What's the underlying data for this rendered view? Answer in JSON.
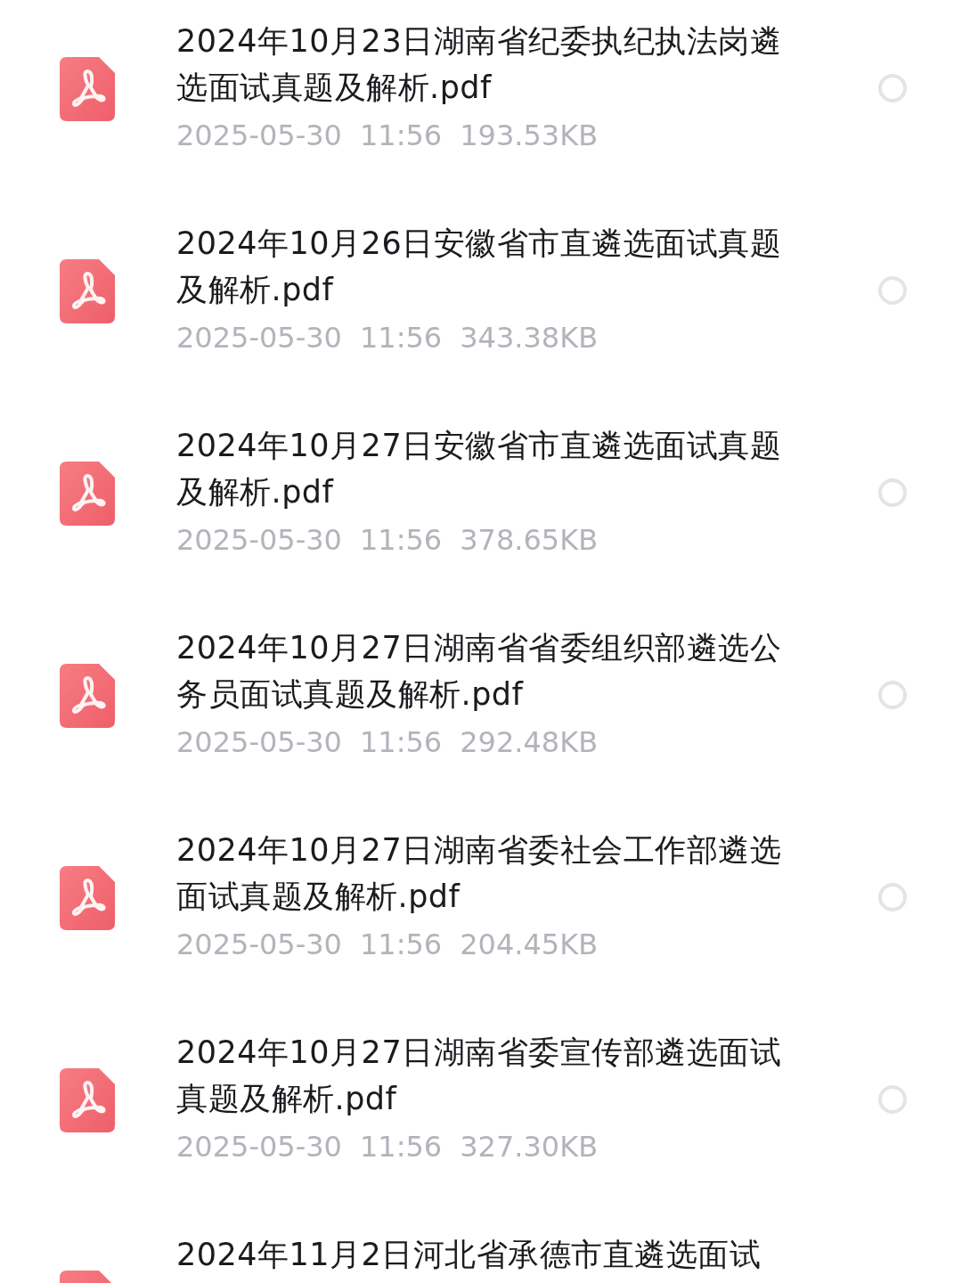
{
  "files": [
    {
      "kind": "pdf",
      "name": "2024年10月23日湖南省纪委执纪执法岗遴选面试真题及解析.pdf",
      "date": "2025-05-30",
      "time": "11:56",
      "size": "193.53KB",
      "selected": false
    },
    {
      "kind": "pdf",
      "name": "2024年10月26日安徽省市直遴选面试真题及解析.pdf",
      "date": "2025-05-30",
      "time": "11:56",
      "size": "343.38KB",
      "selected": false
    },
    {
      "kind": "pdf",
      "name": "2024年10月27日安徽省市直遴选面试真题及解析.pdf",
      "date": "2025-05-30",
      "time": "11:56",
      "size": "378.65KB",
      "selected": false
    },
    {
      "kind": "pdf",
      "name": "2024年10月27日湖南省省委组织部遴选公务员面试真题及解析.pdf",
      "date": "2025-05-30",
      "time": "11:56",
      "size": "292.48KB",
      "selected": false
    },
    {
      "kind": "pdf",
      "name": "2024年10月27日湖南省委社会工作部遴选面试真题及解析.pdf",
      "date": "2025-05-30",
      "time": "11:56",
      "size": "204.45KB",
      "selected": false
    },
    {
      "kind": "pdf",
      "name": "2024年10月27日湖南省委宣传部遴选面试真题及解析.pdf",
      "date": "2025-05-30",
      "time": "11:56",
      "size": "327.30KB",
      "selected": false
    },
    {
      "kind": "pdf",
      "name": "2024年11月2日河北省承德市直遴选面试"
    }
  ]
}
